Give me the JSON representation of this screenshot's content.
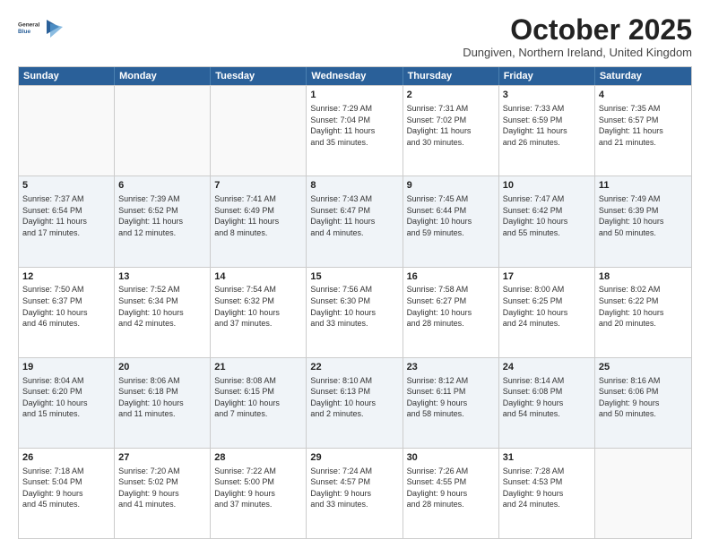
{
  "header": {
    "logo_general": "General",
    "logo_blue": "Blue",
    "month_title": "October 2025",
    "location": "Dungiven, Northern Ireland, United Kingdom"
  },
  "days_of_week": [
    "Sunday",
    "Monday",
    "Tuesday",
    "Wednesday",
    "Thursday",
    "Friday",
    "Saturday"
  ],
  "weeks": [
    [
      {
        "day": "",
        "info": ""
      },
      {
        "day": "",
        "info": ""
      },
      {
        "day": "",
        "info": ""
      },
      {
        "day": "1",
        "info": "Sunrise: 7:29 AM\nSunset: 7:04 PM\nDaylight: 11 hours\nand 35 minutes."
      },
      {
        "day": "2",
        "info": "Sunrise: 7:31 AM\nSunset: 7:02 PM\nDaylight: 11 hours\nand 30 minutes."
      },
      {
        "day": "3",
        "info": "Sunrise: 7:33 AM\nSunset: 6:59 PM\nDaylight: 11 hours\nand 26 minutes."
      },
      {
        "day": "4",
        "info": "Sunrise: 7:35 AM\nSunset: 6:57 PM\nDaylight: 11 hours\nand 21 minutes."
      }
    ],
    [
      {
        "day": "5",
        "info": "Sunrise: 7:37 AM\nSunset: 6:54 PM\nDaylight: 11 hours\nand 17 minutes."
      },
      {
        "day": "6",
        "info": "Sunrise: 7:39 AM\nSunset: 6:52 PM\nDaylight: 11 hours\nand 12 minutes."
      },
      {
        "day": "7",
        "info": "Sunrise: 7:41 AM\nSunset: 6:49 PM\nDaylight: 11 hours\nand 8 minutes."
      },
      {
        "day": "8",
        "info": "Sunrise: 7:43 AM\nSunset: 6:47 PM\nDaylight: 11 hours\nand 4 minutes."
      },
      {
        "day": "9",
        "info": "Sunrise: 7:45 AM\nSunset: 6:44 PM\nDaylight: 10 hours\nand 59 minutes."
      },
      {
        "day": "10",
        "info": "Sunrise: 7:47 AM\nSunset: 6:42 PM\nDaylight: 10 hours\nand 55 minutes."
      },
      {
        "day": "11",
        "info": "Sunrise: 7:49 AM\nSunset: 6:39 PM\nDaylight: 10 hours\nand 50 minutes."
      }
    ],
    [
      {
        "day": "12",
        "info": "Sunrise: 7:50 AM\nSunset: 6:37 PM\nDaylight: 10 hours\nand 46 minutes."
      },
      {
        "day": "13",
        "info": "Sunrise: 7:52 AM\nSunset: 6:34 PM\nDaylight: 10 hours\nand 42 minutes."
      },
      {
        "day": "14",
        "info": "Sunrise: 7:54 AM\nSunset: 6:32 PM\nDaylight: 10 hours\nand 37 minutes."
      },
      {
        "day": "15",
        "info": "Sunrise: 7:56 AM\nSunset: 6:30 PM\nDaylight: 10 hours\nand 33 minutes."
      },
      {
        "day": "16",
        "info": "Sunrise: 7:58 AM\nSunset: 6:27 PM\nDaylight: 10 hours\nand 28 minutes."
      },
      {
        "day": "17",
        "info": "Sunrise: 8:00 AM\nSunset: 6:25 PM\nDaylight: 10 hours\nand 24 minutes."
      },
      {
        "day": "18",
        "info": "Sunrise: 8:02 AM\nSunset: 6:22 PM\nDaylight: 10 hours\nand 20 minutes."
      }
    ],
    [
      {
        "day": "19",
        "info": "Sunrise: 8:04 AM\nSunset: 6:20 PM\nDaylight: 10 hours\nand 15 minutes."
      },
      {
        "day": "20",
        "info": "Sunrise: 8:06 AM\nSunset: 6:18 PM\nDaylight: 10 hours\nand 11 minutes."
      },
      {
        "day": "21",
        "info": "Sunrise: 8:08 AM\nSunset: 6:15 PM\nDaylight: 10 hours\nand 7 minutes."
      },
      {
        "day": "22",
        "info": "Sunrise: 8:10 AM\nSunset: 6:13 PM\nDaylight: 10 hours\nand 2 minutes."
      },
      {
        "day": "23",
        "info": "Sunrise: 8:12 AM\nSunset: 6:11 PM\nDaylight: 9 hours\nand 58 minutes."
      },
      {
        "day": "24",
        "info": "Sunrise: 8:14 AM\nSunset: 6:08 PM\nDaylight: 9 hours\nand 54 minutes."
      },
      {
        "day": "25",
        "info": "Sunrise: 8:16 AM\nSunset: 6:06 PM\nDaylight: 9 hours\nand 50 minutes."
      }
    ],
    [
      {
        "day": "26",
        "info": "Sunrise: 7:18 AM\nSunset: 5:04 PM\nDaylight: 9 hours\nand 45 minutes."
      },
      {
        "day": "27",
        "info": "Sunrise: 7:20 AM\nSunset: 5:02 PM\nDaylight: 9 hours\nand 41 minutes."
      },
      {
        "day": "28",
        "info": "Sunrise: 7:22 AM\nSunset: 5:00 PM\nDaylight: 9 hours\nand 37 minutes."
      },
      {
        "day": "29",
        "info": "Sunrise: 7:24 AM\nSunset: 4:57 PM\nDaylight: 9 hours\nand 33 minutes."
      },
      {
        "day": "30",
        "info": "Sunrise: 7:26 AM\nSunset: 4:55 PM\nDaylight: 9 hours\nand 28 minutes."
      },
      {
        "day": "31",
        "info": "Sunrise: 7:28 AM\nSunset: 4:53 PM\nDaylight: 9 hours\nand 24 minutes."
      },
      {
        "day": "",
        "info": ""
      }
    ]
  ]
}
